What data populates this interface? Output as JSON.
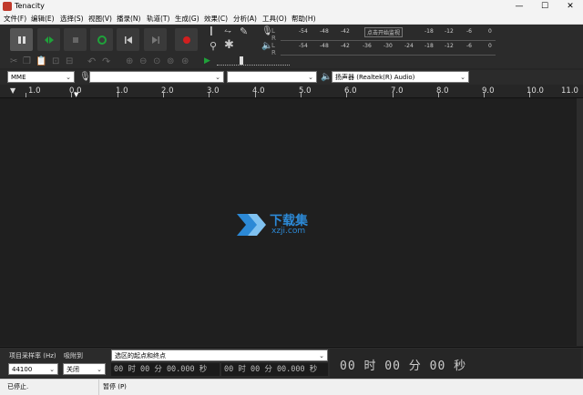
{
  "window": {
    "title": "Tenacity",
    "controls": {
      "minimize": "—",
      "maximize": "☐",
      "close": "✕"
    }
  },
  "menu": [
    "文件(F)",
    "编辑(E)",
    "选择(S)",
    "视图(V)",
    "播录(N)",
    "轨道(T)",
    "生成(G)",
    "效果(C)",
    "分析(A)",
    "工具(O)",
    "帮助(H)"
  ],
  "meters": {
    "record_ticks": [
      "-54",
      "-48",
      "-42",
      "",
      "-18",
      "-12",
      "-6",
      "0"
    ],
    "record_prompt": "点击开始监视",
    "play_ticks": [
      "-54",
      "-48",
      "-42",
      "-36",
      "-30",
      "-24",
      "-18",
      "-12",
      "-6",
      "0"
    ]
  },
  "devices": {
    "host": "MME",
    "recording_device": "",
    "channels": "",
    "playback_device": "扬声器 (Realtek(R) Audio)"
  },
  "ruler": {
    "labels": [
      "1.0",
      "0.0",
      "1.0",
      "2.0",
      "3.0",
      "4.0",
      "5.0",
      "6.0",
      "7.0",
      "8.0",
      "9.0",
      "10.0",
      "11.0"
    ]
  },
  "watermark": {
    "title": "下载集",
    "url": "xzji.com"
  },
  "bottom": {
    "rate_label": "项目采样率 (Hz)",
    "rate_value": "44100",
    "snap_label": "吸附到",
    "snap_value": "关闭",
    "selection_mode": "选区的起点和终点",
    "start_time": "00 时 00 分 00.000 秒",
    "end_time": "00 时 00 分 00.000 秒",
    "audio_position": "00 时 00 分 00 秒"
  },
  "status": {
    "state": "已停止.",
    "hint": "暂停 (P)"
  },
  "colors": {
    "record": "#d11f1f",
    "play": "#1fa23a",
    "loop": "#1fa23a",
    "watermark": "#2c89d6"
  }
}
